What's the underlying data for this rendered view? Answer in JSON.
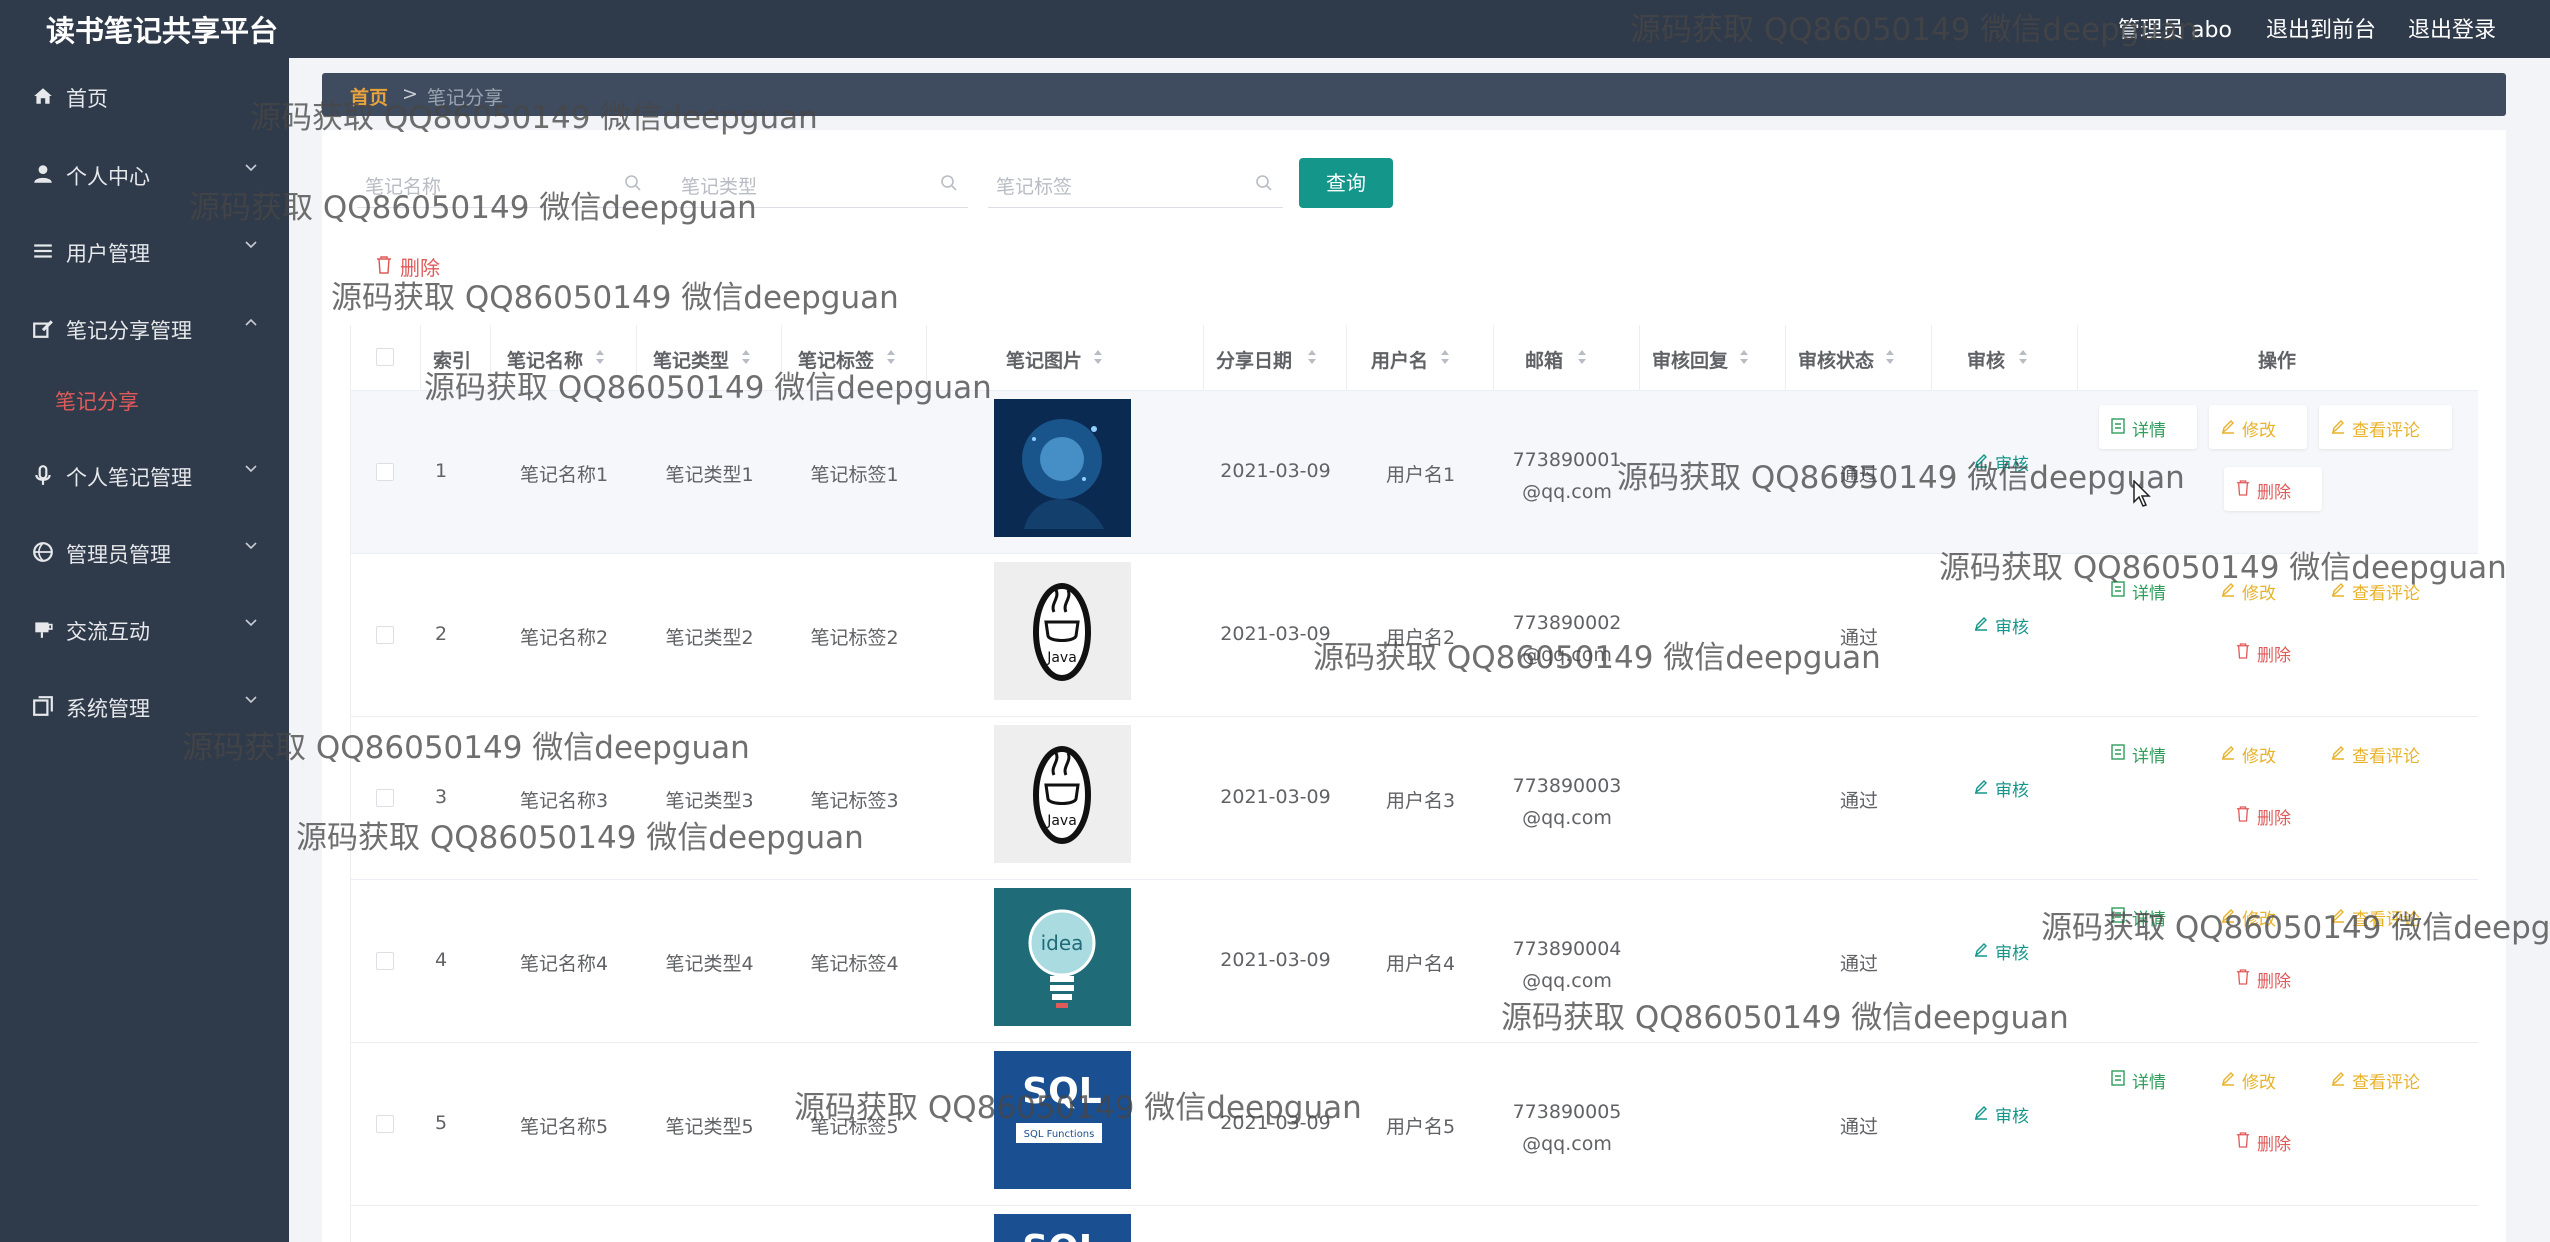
{
  "app": {
    "title": "读书笔记共享平台",
    "user_label": "管理员 abo",
    "front_link": "退出到前台",
    "logout_link": "退出登录"
  },
  "sidebar": {
    "items": [
      {
        "label": "首页",
        "icon": "home-icon"
      },
      {
        "label": "个人中心",
        "icon": "user-icon"
      },
      {
        "label": "用户管理",
        "icon": "list-icon"
      },
      {
        "label": "笔记分享管理",
        "icon": "edit-icon"
      },
      {
        "label": "个人笔记管理",
        "icon": "mic-icon"
      },
      {
        "label": "管理员管理",
        "icon": "globe-icon"
      },
      {
        "label": "交流互动",
        "icon": "cup-icon"
      },
      {
        "label": "系统管理",
        "icon": "copy-icon"
      }
    ],
    "sub_active": "笔记分享",
    "active_color": "#e05a5a"
  },
  "breadcrumb": {
    "home": "首页",
    "separator": ">",
    "current": "笔记分享"
  },
  "search": {
    "name_placeholder": "笔记名称",
    "type_placeholder": "笔记类型",
    "tag_placeholder": "笔记标签",
    "query_button": "查询"
  },
  "toolbar": {
    "delete_label": "删除"
  },
  "table": {
    "headers": {
      "index": "索引",
      "name": "笔记名称",
      "type": "笔记类型",
      "tag": "笔记标签",
      "image": "笔记图片",
      "date": "分享日期",
      "username": "用户名",
      "email": "邮箱",
      "reply": "审核回复",
      "status": "审核状态",
      "review": "审核",
      "actions": "操作"
    },
    "rows": [
      {
        "index": "1",
        "name": "笔记名称1",
        "type": "笔记类型1",
        "tag": "笔记标签1",
        "image": "ai-head-image",
        "date": "2021-03-09",
        "username": "用户名1",
        "email_a": "773890001",
        "email_b": "@qq.com",
        "reply": "",
        "status": "通过",
        "review": "审核"
      },
      {
        "index": "2",
        "name": "笔记名称2",
        "type": "笔记类型2",
        "tag": "笔记标签2",
        "image": "java-logo-image",
        "date": "2021-03-09",
        "username": "用户名2",
        "email_a": "773890002",
        "email_b": "@qq.com",
        "reply": "",
        "status": "通过",
        "review": "审核"
      },
      {
        "index": "3",
        "name": "笔记名称3",
        "type": "笔记类型3",
        "tag": "笔记标签3",
        "image": "java-logo-image",
        "date": "2021-03-09",
        "username": "用户名3",
        "email_a": "773890003",
        "email_b": "@qq.com",
        "reply": "",
        "status": "通过",
        "review": "审核"
      },
      {
        "index": "4",
        "name": "笔记名称4",
        "type": "笔记类型4",
        "tag": "笔记标签4",
        "image": "idea-bulb-image",
        "date": "2021-03-09",
        "username": "用户名4",
        "email_a": "773890004",
        "email_b": "@qq.com",
        "reply": "",
        "status": "通过",
        "review": "审核"
      },
      {
        "index": "5",
        "name": "笔记名称5",
        "type": "笔记类型5",
        "tag": "笔记标签5",
        "image": "sql-book-image",
        "date": "2021-03-09",
        "username": "用户名5",
        "email_a": "773890005",
        "email_b": "@qq.com",
        "reply": "",
        "status": "通过",
        "review": "审核"
      }
    ],
    "actions": {
      "detail": "详情",
      "edit": "修改",
      "comments": "查看评论",
      "delete": "删除"
    }
  },
  "images": {
    "sql_title": "SQL",
    "sql_subtitle": "SQL Functions",
    "idea_text": "idea",
    "java_text": "Java"
  },
  "watermark": "源码获取 QQ86050149 微信deepguan",
  "colors": {
    "header_bg": "#2f3a4a",
    "primary": "#14968a",
    "breadcrumb_bg": "#3f4b5e",
    "detail": "#2e9e5a",
    "edit": "#e8b22a",
    "delete": "#e05a5a"
  }
}
